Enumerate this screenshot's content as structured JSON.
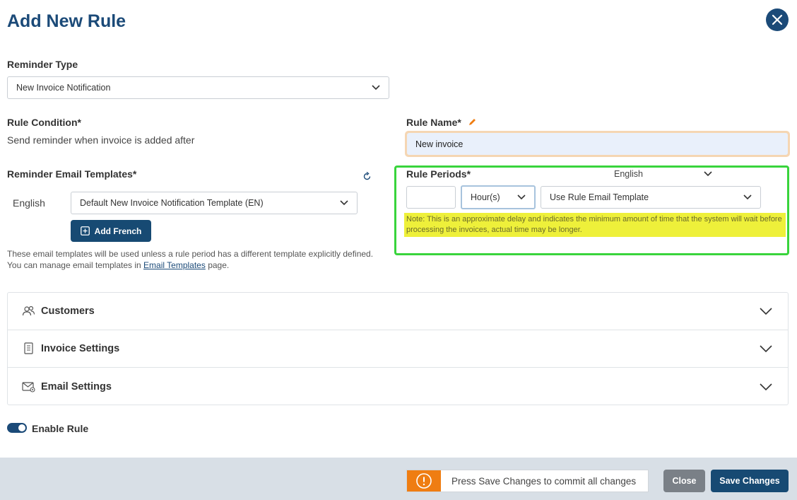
{
  "header": {
    "title": "Add New Rule",
    "close_icon": "close-icon"
  },
  "reminder_type": {
    "label": "Reminder Type",
    "value": "New Invoice Notification"
  },
  "rule_condition": {
    "label": "Rule Condition*",
    "text": "Send reminder when invoice is added after"
  },
  "rule_name": {
    "label": "Rule Name*",
    "value": "New invoice",
    "edit_icon": "pencil-icon"
  },
  "email_templates": {
    "label": "Reminder Email Templates*",
    "refresh_icon": "refresh-icon",
    "language": "English",
    "template_value": "Default New Invoice Notification Template (EN)",
    "add_french_label": "Add French",
    "help_text": "These email templates will be used unless a rule period has a different template explicitly defined. You can manage email templates in",
    "help_link": "Email Templates",
    "help_suffix": "page."
  },
  "rule_periods": {
    "label": "Rule Periods*",
    "language": "English",
    "delay_value": "",
    "unit": "Hour(s)",
    "template": "Use Rule Email Template",
    "note": "Note: This is an approximate delay and indicates the minimum amount of time that the system will wait before processing the invoices, actual time may be longer."
  },
  "sections": [
    {
      "label": "Customers",
      "icon": "users-icon"
    },
    {
      "label": "Invoice Settings",
      "icon": "document-icon"
    },
    {
      "label": "Email Settings",
      "icon": "email-settings-icon"
    }
  ],
  "enable_rule": {
    "label": "Enable Rule",
    "on": true
  },
  "footer": {
    "info_icon": "info-icon",
    "info_text": "Press Save Changes to commit all changes",
    "close_label": "Close",
    "save_label": "Save Changes"
  },
  "colors": {
    "primary": "#1b4a78",
    "accent": "#ef7d12",
    "highlight": "#39d43c",
    "note_bg": "#eef03a"
  }
}
